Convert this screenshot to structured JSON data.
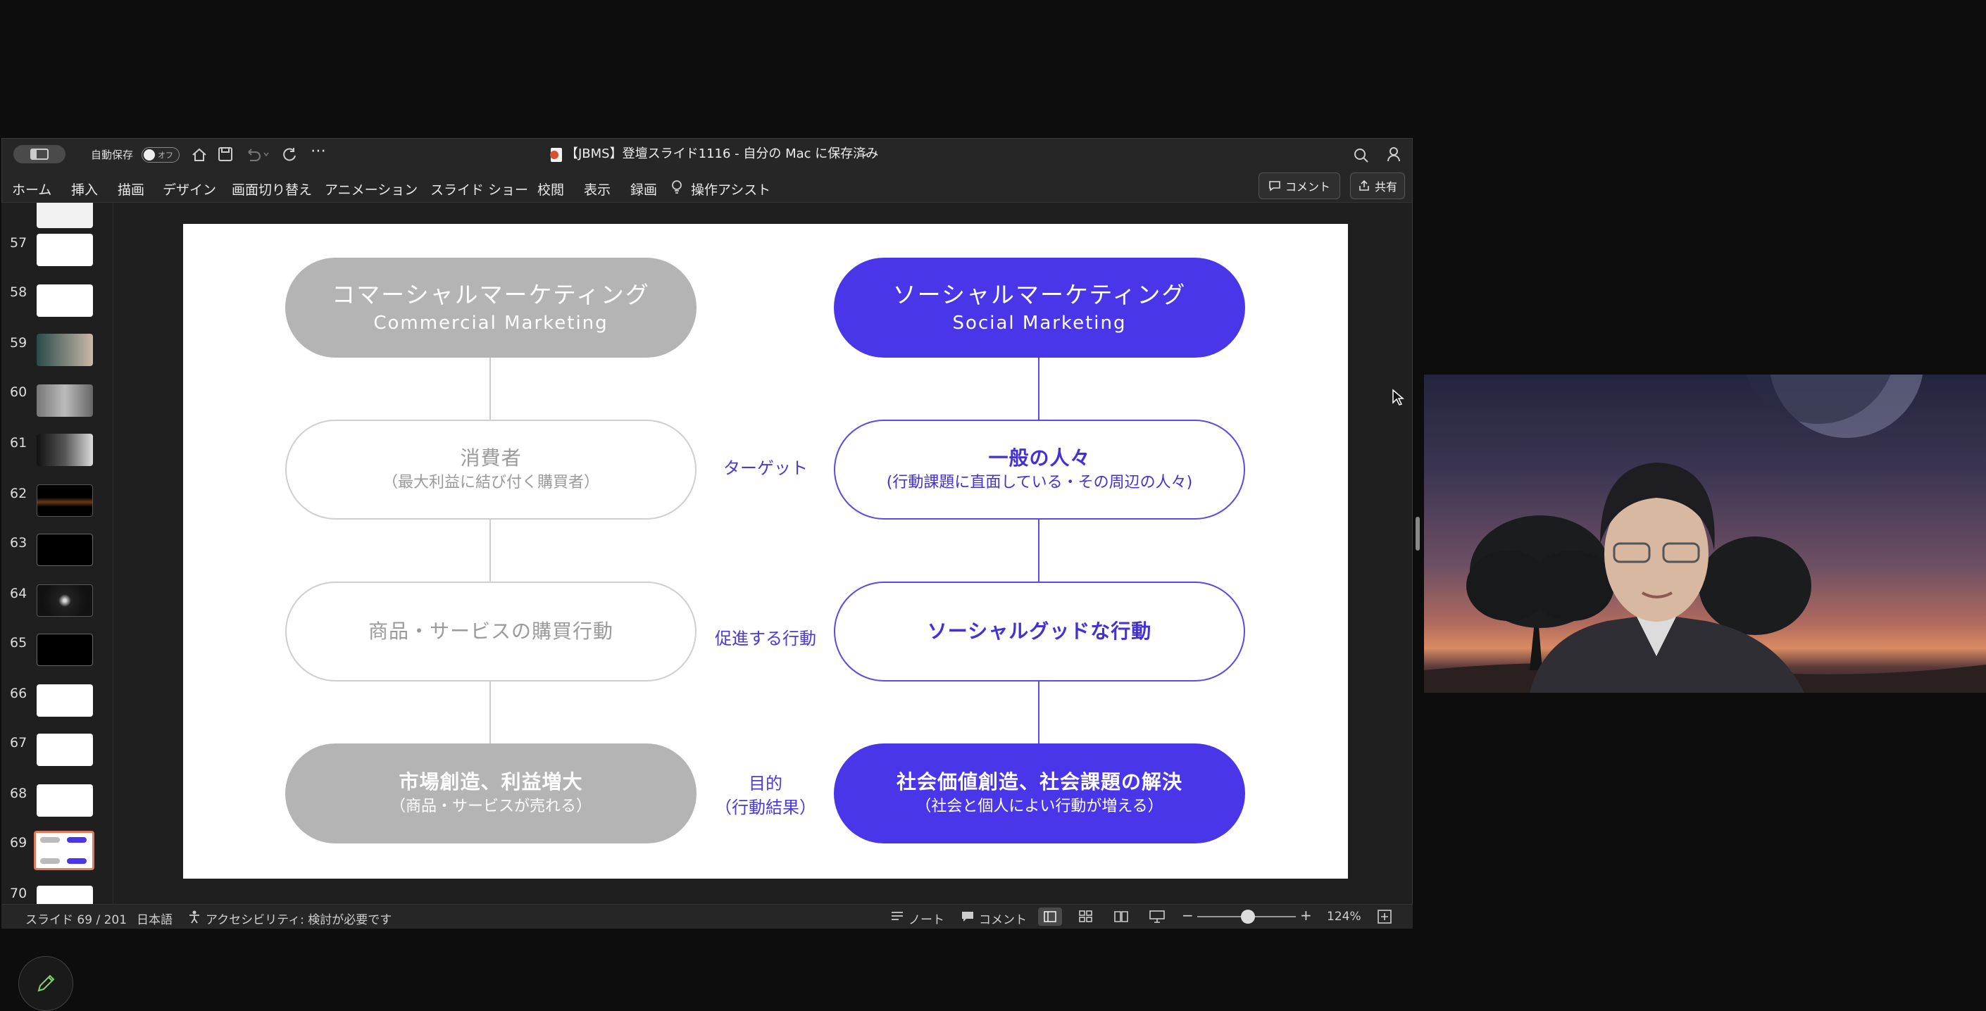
{
  "titlebar": {
    "autosave_label": "自動保存",
    "autosave_state": "オフ",
    "document_title": "【JBMS】登壇スライド1116 - 自分の Mac に保存済み"
  },
  "menu": {
    "items": [
      "ホーム",
      "挿入",
      "描画",
      "デザイン",
      "画面切り替え",
      "アニメーション",
      "スライド ショー",
      "校閲",
      "表示",
      "録画"
    ],
    "assist": "操作アシスト",
    "comment_button": "コメント",
    "share_button": "共有"
  },
  "thumbnails": {
    "numbers": [
      "57",
      "58",
      "59",
      "60",
      "61",
      "62",
      "63",
      "64",
      "65",
      "66",
      "67",
      "68",
      "69",
      "70"
    ],
    "selected": "69"
  },
  "slide": {
    "left_column": {
      "header_title": "コマーシャルマーケティング",
      "header_subtitle": "Commercial Marketing",
      "target_title": "消費者",
      "target_sub": "（最大利益に結び付く購買者）",
      "action_title": "商品・サービスの購買行動",
      "goal_title": "市場創造、利益増大",
      "goal_sub": "（商品・サービスが売れる）"
    },
    "right_column": {
      "header_title": "ソーシャルマーケティング",
      "header_subtitle": "Social Marketing",
      "target_title": "一般の人々",
      "target_sub": "(行動課題に直面している・その周辺の人々)",
      "action_title": "ソーシャルグッドな行動",
      "goal_title": "社会価値創造、社会課題の解決",
      "goal_sub": "（社会と個人によい行動が増える）"
    },
    "middle_labels": {
      "target": "ターゲット",
      "action": "促進する行動",
      "goal_line1": "目的",
      "goal_line2": "（行動結果）"
    },
    "colors": {
      "accent_blue": "#4936e8",
      "gray_fill": "#b4b4b4"
    }
  },
  "statusbar": {
    "slide_info": "スライド 69 / 201",
    "language": "日本語",
    "accessibility": "アクセシビリティ: 検討が必要です",
    "notes": "ノート",
    "comments": "コメント",
    "zoom": "124%"
  }
}
